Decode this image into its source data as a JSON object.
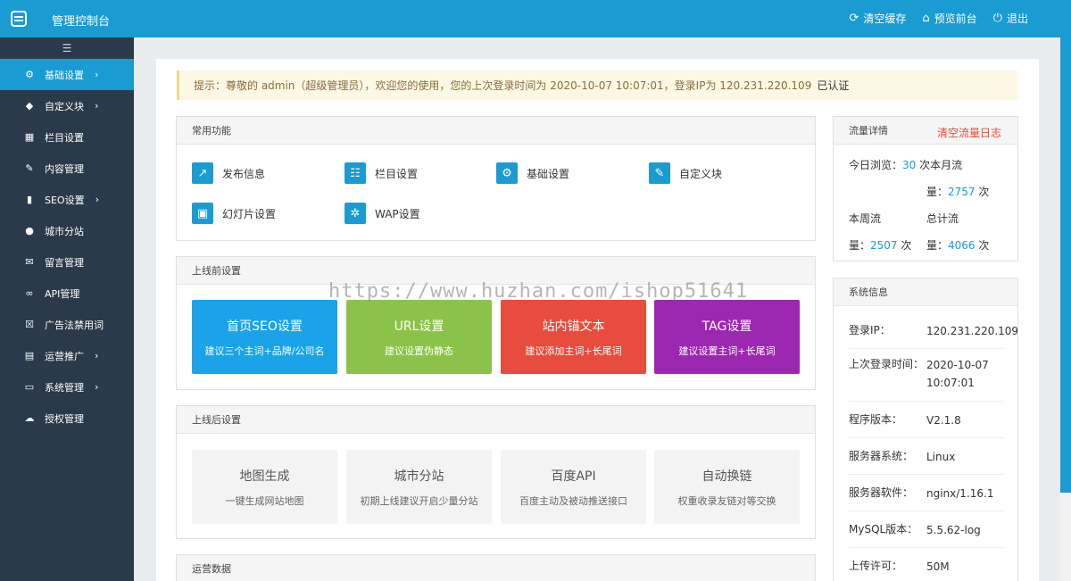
{
  "header": {
    "title": "管理控制台",
    "actions": [
      {
        "label": "清空缓存",
        "icon": "refresh-icon"
      },
      {
        "label": "预览前台",
        "icon": "home-icon"
      },
      {
        "label": "退出",
        "icon": "power-icon"
      }
    ]
  },
  "sidebar": {
    "items": [
      {
        "label": "基础设置",
        "icon": "gear-icon",
        "expandable": true,
        "active": true
      },
      {
        "label": "自定义块",
        "icon": "tag-icon",
        "expandable": true
      },
      {
        "label": "栏目设置",
        "icon": "grid-icon",
        "expandable": false
      },
      {
        "label": "内容管理",
        "icon": "edit-icon",
        "expandable": false
      },
      {
        "label": "SEO设置",
        "icon": "bar-chart-icon",
        "expandable": true
      },
      {
        "label": "城市分站",
        "icon": "globe-icon",
        "expandable": false
      },
      {
        "label": "留言管理",
        "icon": "comment-icon",
        "expandable": false
      },
      {
        "label": "API管理",
        "icon": "link-icon",
        "expandable": false
      },
      {
        "label": "广告法禁用词",
        "icon": "close-box-icon",
        "expandable": false
      },
      {
        "label": "运营推广",
        "icon": "table-icon",
        "expandable": true
      },
      {
        "label": "系统管理",
        "icon": "monitor-icon",
        "expandable": true
      },
      {
        "label": "授权管理",
        "icon": "cloud-upload-icon",
        "expandable": false
      }
    ]
  },
  "notice": {
    "text": "提示：尊敬的 admin（超级管理员），欢迎您的使用，您的上次登录时间为 2020-10-07 10:07:01，登录IP为 120.231.220.109",
    "badge": "已认证"
  },
  "common": {
    "title": "常用功能",
    "items": [
      {
        "label": "发布信息",
        "icon": "share-icon"
      },
      {
        "label": "栏目设置",
        "icon": "settings-list-icon"
      },
      {
        "label": "基础设置",
        "icon": "gear-icon"
      },
      {
        "label": "自定义块",
        "icon": "edit-list-icon"
      },
      {
        "label": "幻灯片设置",
        "icon": "slides-icon"
      },
      {
        "label": "WAP设置",
        "icon": "cog-icon"
      }
    ]
  },
  "pre_launch": {
    "title": "上线前设置",
    "tiles": [
      {
        "title": "首页SEO设置",
        "desc": "建议三个主词+品牌/公司名",
        "color": "#1aa3e8"
      },
      {
        "title": "URL设置",
        "desc": "建议设置伪静态",
        "color": "#8bc34a"
      },
      {
        "title": "站内锚文本",
        "desc": "建议添加主词+长尾词",
        "color": "#e74c3c"
      },
      {
        "title": "TAG设置",
        "desc": "建议设置主词+长尾词",
        "color": "#9c27b0"
      }
    ]
  },
  "post_launch": {
    "title": "上线后设置",
    "tiles": [
      {
        "title": "地图生成",
        "desc": "一键生成网站地图"
      },
      {
        "title": "城市分站",
        "desc": "初期上线建议开启少量分站"
      },
      {
        "title": "百度API",
        "desc": "百度主动及被动推送接口"
      },
      {
        "title": "自动换链",
        "desc": "权重收录友链对等交换"
      }
    ]
  },
  "operations": {
    "title": "运营数据"
  },
  "traffic": {
    "title": "流量详情",
    "clear_label": "清空流量日志",
    "today_label": "今日浏览：",
    "today_value": "30",
    "times": "次",
    "month_label_a": "本月流",
    "month_label_b": "量：",
    "month_value": "2757",
    "week_label_a": "本周流",
    "week_label_b": "量：",
    "week_value": "2507",
    "total_label_a": "总计流",
    "total_label_b": "量：",
    "total_value": "4066"
  },
  "system": {
    "title": "系统信息",
    "rows": [
      {
        "key": "登录IP：",
        "value": "120.231.220.109"
      },
      {
        "key": "上次登录时间：",
        "value": "2020-10-07 10:07:01"
      },
      {
        "key": "程序版本：",
        "value": "V2.1.8"
      },
      {
        "key": "服务器系统：",
        "value": "Linux"
      },
      {
        "key": "服务器软件：",
        "value": "nginx/1.16.1"
      },
      {
        "key": "MySQL版本：",
        "value": "5.5.62-log"
      },
      {
        "key": "上传许可：",
        "value": "50M"
      }
    ]
  },
  "watermark": "https://www.huzhan.com/ishop51641",
  "colors": {
    "brand": "#1a9bd1",
    "sidebar": "#2b3a4a",
    "danger": "#e74c3c"
  }
}
